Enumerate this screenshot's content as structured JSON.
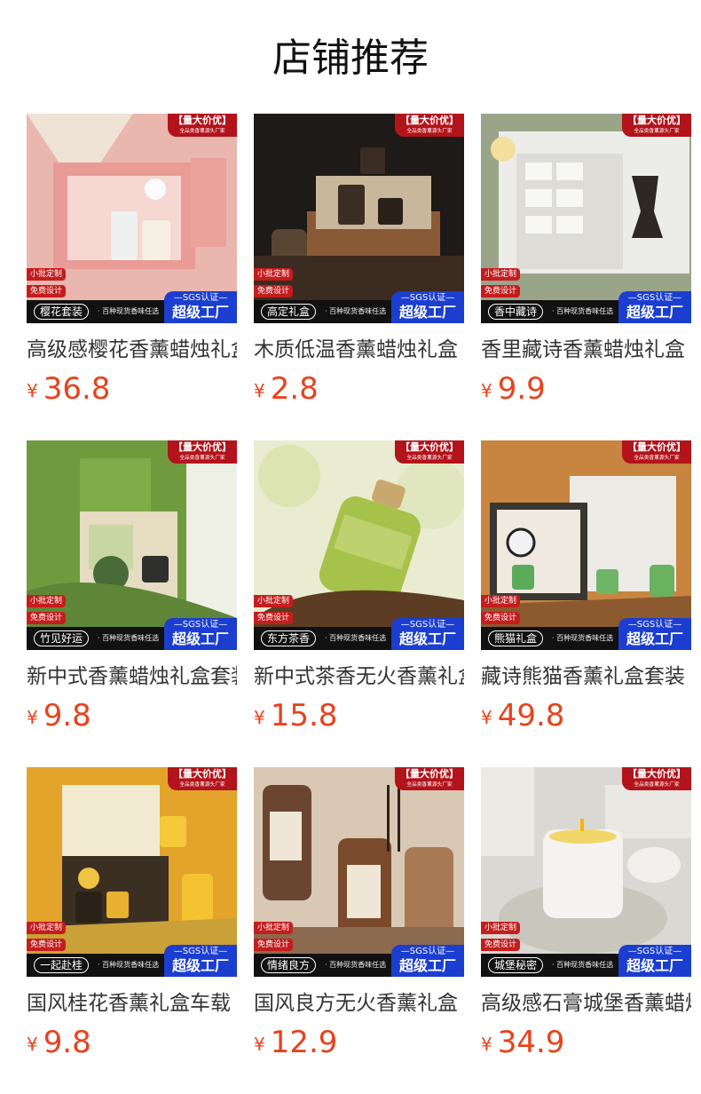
{
  "header": {
    "title": "店铺推荐"
  },
  "badges": {
    "top_main": "【量大价优】",
    "top_sub": "全品类香薰源头厂家",
    "tag_small_1": "小批定制",
    "tag_small_2": "免费设计",
    "bar_sub": "· 百种现货香味任选",
    "factory_top": "—SGS认证—",
    "factory_main": "超级工厂"
  },
  "currency": "¥",
  "products": [
    {
      "name": "樱花套装",
      "title": "高级感樱花香薰蜡烛礼盒",
      "price": "36.8",
      "scene": "pink"
    },
    {
      "name": "高定礼盒",
      "title": "木质低温香薰蜡烛礼盒",
      "price": "2.8",
      "scene": "wood"
    },
    {
      "name": "香中藏诗",
      "title": "香里藏诗香薰蜡烛礼盒",
      "price": "9.9",
      "scene": "white"
    },
    {
      "name": "竹见好运",
      "title": "新中式香薰蜡烛礼盒套装",
      "price": "9.8",
      "scene": "green"
    },
    {
      "name": "东方茶香",
      "title": "新中式茶香无火香薰礼盒",
      "price": "15.8",
      "scene": "bottle"
    },
    {
      "name": "熊猫礼盒",
      "title": "藏诗熊猫香薰礼盒套装",
      "price": "49.8",
      "scene": "panda"
    },
    {
      "name": "一起赴桂",
      "title": "国风桂花香薰礼盒车载",
      "price": "9.8",
      "scene": "osmanthus"
    },
    {
      "name": "情绪良方",
      "title": "国风良方无火香薰礼盒",
      "price": "12.9",
      "scene": "amber"
    },
    {
      "name": "城堡秘密",
      "title": "高级感石膏城堡香薰蜡烛",
      "price": "34.9",
      "scene": "castle"
    }
  ],
  "colors": {
    "price": "#e9421c",
    "badge_red": "#b3131b",
    "factory_blue": "#1b3ed1"
  }
}
